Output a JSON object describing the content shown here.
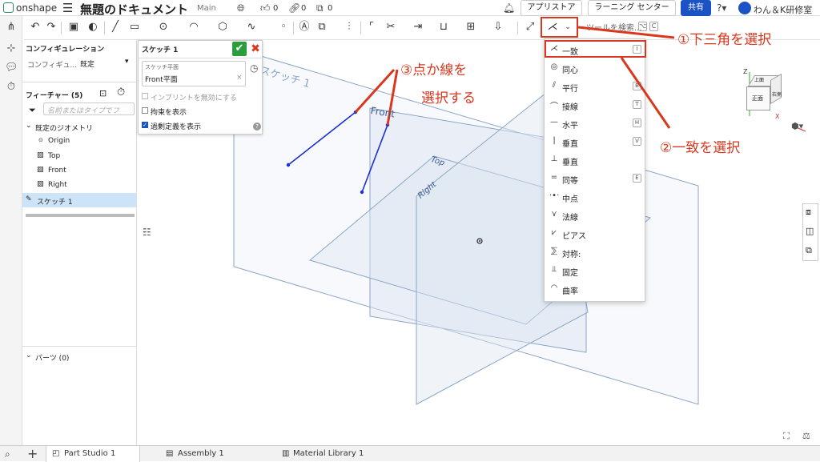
{
  "header": {
    "logo": "onshape",
    "doc_title": "無題のドキュメント",
    "workspace": "Main",
    "likes": "0",
    "links": "0",
    "copies": "0",
    "app_store": "アプリストア",
    "learning_center": "ラーニング センター",
    "share": "共有",
    "user": "わん＆K研修室"
  },
  "toolbar": {
    "search_label": "ツールを検索...",
    "search_shortcut_1": "⌥",
    "search_shortcut_2": "C"
  },
  "feature_panel": {
    "config_title": "コンフィギュレーション",
    "config_label": "コンフィギュ...",
    "config_value": "既定",
    "features_title": "フィーチャー (5)",
    "filter_placeholder": "名前またはタイプでフ",
    "default_geometry": "既定のジオメトリ",
    "items": [
      "Origin",
      "Top",
      "Front",
      "Right"
    ],
    "sketch": "スケッチ 1",
    "parts": "パーツ (0)"
  },
  "sketch_dialog": {
    "title": "スケッチ 1",
    "plane_label": "スケッチ平面",
    "plane_value": "Front平面",
    "opt1": "インプリントを無効にする",
    "opt2": "拘束を表示",
    "opt3": "過剰定義を表示"
  },
  "viewport": {
    "sketch_label": "スケッチ 1",
    "front_label": "Front",
    "top_label": "Top",
    "right_label": "Right",
    "cube_top": "上面",
    "cube_front": "正面",
    "cube_right": "右側",
    "axis_z": "Z",
    "axis_x": "X"
  },
  "constraint_menu": {
    "items": [
      {
        "icon": "⋌",
        "label": "一致",
        "key": "I"
      },
      {
        "icon": "◎",
        "label": "同心",
        "key": ""
      },
      {
        "icon": "⫽",
        "label": "平行",
        "key": "B"
      },
      {
        "icon": "⌒",
        "label": "接線",
        "key": "T"
      },
      {
        "icon": "—",
        "label": "水平",
        "key": "H"
      },
      {
        "icon": "|",
        "label": "垂直",
        "key": "V"
      },
      {
        "icon": "⊥",
        "label": "垂直",
        "key": ""
      },
      {
        "icon": "=",
        "label": "同等",
        "key": "E"
      },
      {
        "icon": "·•·",
        "label": "中点",
        "key": ""
      },
      {
        "icon": "⋎",
        "label": "法線",
        "key": ""
      },
      {
        "icon": "⩗",
        "label": "ピアス",
        "key": ""
      },
      {
        "icon": "⅀",
        "label": "対称:",
        "key": ""
      },
      {
        "icon": "⫫",
        "label": "固定",
        "key": ""
      },
      {
        "icon": "◠",
        "label": "曲率",
        "key": ""
      }
    ]
  },
  "annotations": {
    "a1": "①下三角を選択",
    "a2": "②一致を選択",
    "a3_line1": "③点か線を",
    "a3_line2": "選択する"
  },
  "bottom_tabs": [
    "Part Studio 1",
    "Assembly 1",
    "Material Library 1"
  ],
  "colors": {
    "accent": "#1b52c4",
    "annotation": "#d9381e",
    "sketch_line": "#1a2fd6",
    "plane": "#8aa6c8"
  }
}
